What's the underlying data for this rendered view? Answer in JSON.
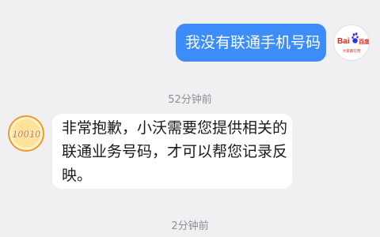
{
  "messages": [
    {
      "from": "user",
      "text": "我没有联通手机号码"
    },
    {
      "timestamp": "52分钟前"
    },
    {
      "from": "agent",
      "lines": [
        "非常抱歉，小沃需要您提供相关的",
        "联通业务号码，才可以帮您记录反",
        "映。"
      ]
    },
    {
      "timestamp": "2分钟前"
    }
  ],
  "user_avatar": {
    "logo_text_a": "Bai",
    "logo_text_b": "百度",
    "caption": "大家都在用"
  },
  "agent_avatar": {
    "logo_text": "10010"
  },
  "colors": {
    "background": "#f0f0f2",
    "outgoing_bubble": "#3c8dfa",
    "incoming_bubble": "#ffffff",
    "baidu_red": "#e1261c",
    "baidu_blue": "#2932e1",
    "agent_orange": "#f29a1f"
  }
}
